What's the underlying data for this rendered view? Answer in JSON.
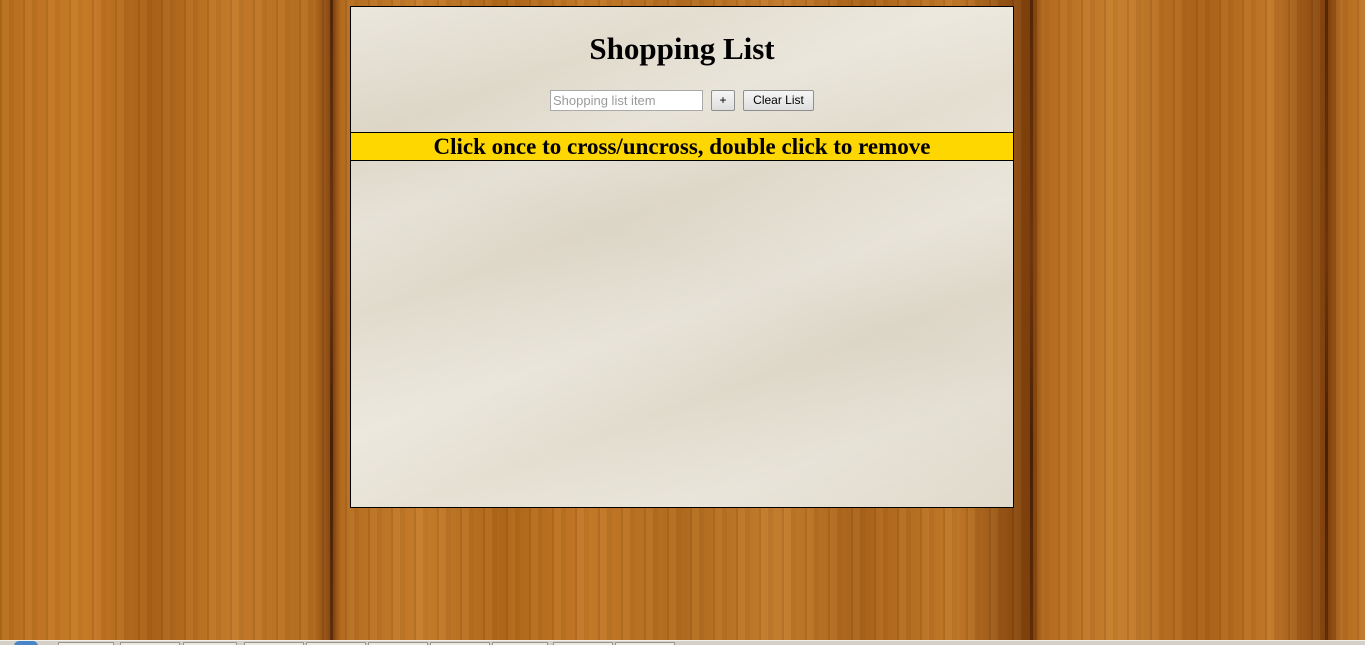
{
  "page": {
    "title": "Shopping List"
  },
  "add_form": {
    "input_placeholder": "Shopping list item",
    "input_value": "",
    "add_button_label": "+",
    "clear_button_label": "Clear List"
  },
  "instructions": {
    "text": "Click once to cross/uncross, double click to remove",
    "background_color": "#ffd700"
  },
  "list": {
    "items": []
  },
  "colors": {
    "panel_background": "#e7e2d5",
    "wood_background": "#b66d1e"
  }
}
